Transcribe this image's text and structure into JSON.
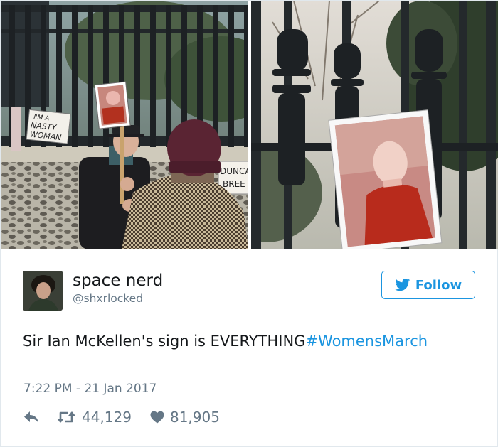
{
  "tweet": {
    "author": {
      "display_name": "space nerd",
      "handle": "@shxrlocked"
    },
    "follow_label": "Follow",
    "text": "Sir Ian McKellen's sign is EVERYTHING",
    "hashtag": "#WomensMarch",
    "timestamp": "7:22 PM - 21 Jan 2017",
    "stats": {
      "retweets": "44,129",
      "likes": "81,905"
    }
  },
  "media": {
    "left_sign_text": "I'M A NASTY WOMAN",
    "left_banner_text": "DUNCA BREE"
  },
  "icons": {
    "follow": "twitter-bird-icon",
    "reply": "reply-icon",
    "retweet": "retweet-icon",
    "like": "heart-icon"
  },
  "colors": {
    "accent": "#1b95e0",
    "text": "#14171a",
    "muted": "#657786",
    "border": "#e1e8ed"
  }
}
